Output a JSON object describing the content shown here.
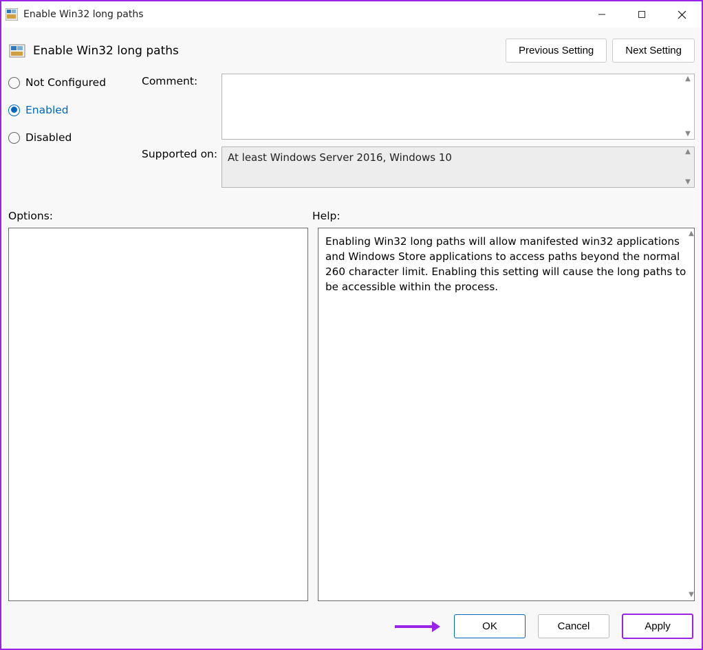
{
  "window": {
    "title": "Enable Win32 long paths"
  },
  "header": {
    "title": "Enable Win32 long paths",
    "previous_label": "Previous Setting",
    "next_label": "Next Setting"
  },
  "config": {
    "radios": {
      "not_configured": "Not Configured",
      "enabled": "Enabled",
      "disabled": "Disabled",
      "selected": "enabled"
    },
    "comment_label": "Comment:",
    "comment_value": "",
    "supported_label": "Supported on:",
    "supported_value": "At least Windows Server 2016, Windows 10"
  },
  "panels": {
    "options_label": "Options:",
    "options_content": "",
    "help_label": "Help:",
    "help_content": "Enabling Win32 long paths will allow manifested win32 applications and Windows Store applications to access paths beyond the normal 260 character limit.  Enabling this setting will cause the long paths to be accessible within the process."
  },
  "buttons": {
    "ok": "OK",
    "cancel": "Cancel",
    "apply": "Apply"
  }
}
